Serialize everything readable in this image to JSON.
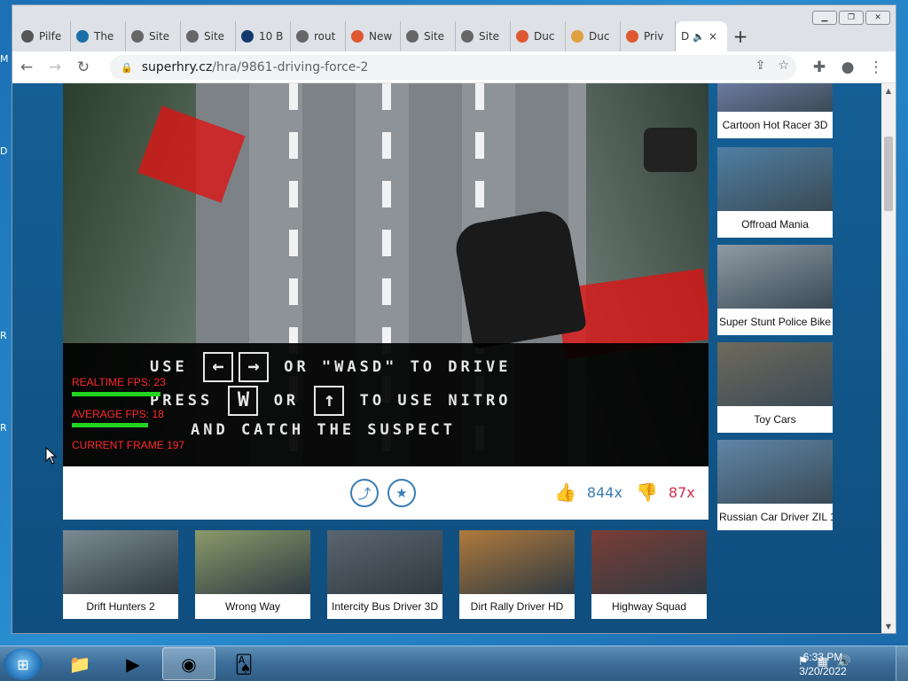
{
  "browser": {
    "tabs": [
      {
        "label": "Pilfe",
        "icon": "roblox-icon",
        "color": "#555555"
      },
      {
        "label": "The",
        "icon": "tr-icon",
        "color": "#1a6fa8"
      },
      {
        "label": "Site",
        "icon": "globe-icon",
        "color": "#666666"
      },
      {
        "label": "Site",
        "icon": "globe-icon",
        "color": "#666666"
      },
      {
        "label": "10 B",
        "icon": "v-icon",
        "color": "#123a6b"
      },
      {
        "label": "rout",
        "icon": "globe-icon",
        "color": "#666666"
      },
      {
        "label": "New",
        "icon": "duckduckgo-icon",
        "color": "#de5833"
      },
      {
        "label": "Site",
        "icon": "globe-icon",
        "color": "#666666"
      },
      {
        "label": "Site",
        "icon": "globe-icon",
        "color": "#666666"
      },
      {
        "label": "Duc",
        "icon": "duckduckgo-icon",
        "color": "#de5833"
      },
      {
        "label": "Duc",
        "icon": "rainbow-icon",
        "color": "#e0a040"
      },
      {
        "label": "Priv",
        "icon": "duckduckgo-icon",
        "color": "#de5833"
      }
    ],
    "active_tab": {
      "label": "D",
      "audio_icon": "speaker-icon",
      "close": "×"
    },
    "new_tab": "+",
    "url_domain": "superhry.cz",
    "url_path": "/hra/9861-driving-force-2"
  },
  "game": {
    "line1_pre": "USE",
    "line1_key_left": "←",
    "line1_key_right": "→",
    "line1_post": "OR \"WASD\" TO DRIVE",
    "line2_pre": "PRESS",
    "line2_key_w": "W",
    "line2_mid": "OR",
    "line2_key_up": "↑",
    "line2_post": "TO USE NITRO",
    "line3": "AND CATCH THE SUSPECT",
    "realtime_fps": "REALTIME FPS: 23",
    "average_fps": "AVERAGE FPS: 18",
    "current_frame": "CURRENT FRAME 197"
  },
  "actions": {
    "likes": "844x",
    "dislikes": "87x"
  },
  "side_games": [
    {
      "label": "Cartoon Hot Racer 3D",
      "color": "#6d7aa0"
    },
    {
      "label": "Offroad Mania",
      "color": "#4f7fa3"
    },
    {
      "label": "Super Stunt Police Bike ...",
      "color": "#8f9aa4"
    },
    {
      "label": "Toy Cars",
      "color": "#6f6a5c"
    },
    {
      "label": "Russian Car Driver ZIL 1...",
      "color": "#5f86a8"
    }
  ],
  "bottom_games": [
    {
      "label": "Drift Hunters 2",
      "color": "#7c8b93"
    },
    {
      "label": "Wrong Way",
      "color": "#8a9a6a"
    },
    {
      "label": "Intercity Bus Driver 3D",
      "color": "#5b6570"
    },
    {
      "label": "Dirt Rally Driver HD",
      "color": "#b07a3c"
    },
    {
      "label": "Highway Squad",
      "color": "#7a3d36"
    }
  ],
  "taskbar": {
    "time": "6:33 PM",
    "date": "3/20/2022"
  }
}
